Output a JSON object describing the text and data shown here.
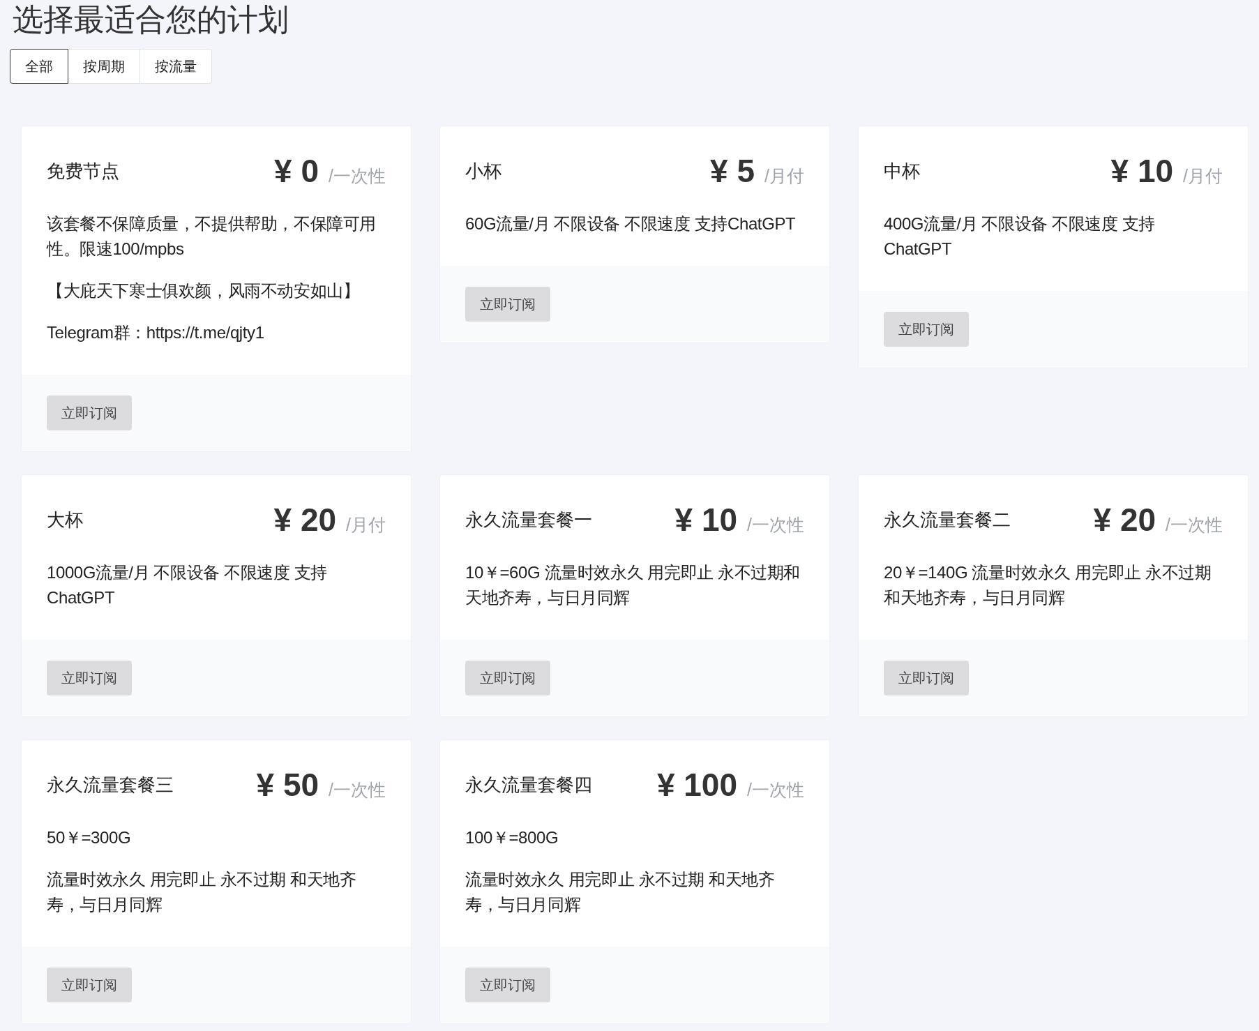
{
  "title": "选择最适合您的计划",
  "tabs": [
    {
      "label": "全部",
      "selected": true
    },
    {
      "label": "按周期",
      "selected": false
    },
    {
      "label": "按流量",
      "selected": false
    }
  ],
  "plans": [
    {
      "name": "免费节点",
      "price": "¥ 0",
      "period": "/一次性",
      "description": [
        "该套餐不保障质量，不提供帮助，不保障可用性。限速100/mpbs",
        "【大庇天下寒士俱欢颜，风雨不动安如山】",
        "Telegram群：https://t.me/qjty1"
      ],
      "button": "立即订阅"
    },
    {
      "name": "小杯",
      "price": "¥ 5",
      "period": "/月付",
      "description": [
        "60G流量/月 不限设备 不限速度 支持ChatGPT"
      ],
      "button": "立即订阅"
    },
    {
      "name": "中杯",
      "price": "¥ 10",
      "period": "/月付",
      "description": [
        "400G流量/月 不限设备 不限速度 支持ChatGPT"
      ],
      "button": "立即订阅"
    },
    {
      "name": "大杯",
      "price": "¥ 20",
      "period": "/月付",
      "description": [
        "1000G流量/月 不限设备 不限速度 支持ChatGPT"
      ],
      "button": "立即订阅"
    },
    {
      "name": "永久流量套餐一",
      "price": "¥ 10",
      "period": "/一次性",
      "description": [
        "10￥=60G 流量时效永久 用完即止 永不过期和天地齐寿，与日月同辉"
      ],
      "button": "立即订阅"
    },
    {
      "name": "永久流量套餐二",
      "price": "¥ 20",
      "period": "/一次性",
      "description": [
        "20￥=140G 流量时效永久 用完即止 永不过期和天地齐寿，与日月同辉"
      ],
      "button": "立即订阅"
    },
    {
      "name": "永久流量套餐三",
      "price": "¥ 50",
      "period": "/一次性",
      "description": [
        "50￥=300G",
        "流量时效永久 用完即止 永不过期 和天地齐寿，与日月同辉"
      ],
      "button": "立即订阅"
    },
    {
      "name": "永久流量套餐四",
      "price": "¥ 100",
      "period": "/一次性",
      "description": [
        "100￥=800G",
        "流量时效永久 用完即止 永不过期 和天地齐寿，与日月同辉"
      ],
      "button": "立即订阅"
    }
  ]
}
